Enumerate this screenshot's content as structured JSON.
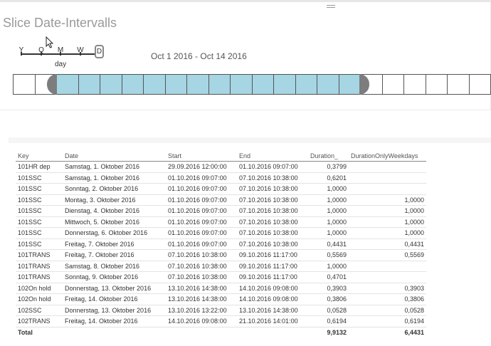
{
  "visual": {
    "title": "Slice Date-Intervalls",
    "granularity": {
      "levels": [
        "Y",
        "Q",
        "M",
        "W",
        "D"
      ],
      "selected": "D",
      "current_label": "day"
    },
    "range_label": "Oct 1 2016 - Oct 14 2016",
    "timeline": {
      "total_cells": 22,
      "selected_start_index": 2,
      "selected_end_index": 15,
      "selected_color": "#a6d5e3",
      "handle_color": "#7d7d7d"
    }
  },
  "table": {
    "columns": [
      "Key",
      "Date",
      "Start",
      "End",
      "Duration_",
      "DurationOnlyWeekdays"
    ],
    "rows": [
      [
        "101HR dep",
        "Samstag, 1. Oktober 2016",
        "29.09.2016 12:00:00",
        "01.10.2016 09:07:00",
        "0,3799",
        ""
      ],
      [
        "101SSC",
        "Samstag, 1. Oktober 2016",
        "01.10.2016 09:07:00",
        "07.10.2016 10:38:00",
        "0,6201",
        ""
      ],
      [
        "101SSC",
        "Sonntag, 2. Oktober 2016",
        "01.10.2016 09:07:00",
        "07.10.2016 10:38:00",
        "1,0000",
        ""
      ],
      [
        "101SSC",
        "Montag, 3. Oktober 2016",
        "01.10.2016 09:07:00",
        "07.10.2016 10:38:00",
        "1,0000",
        "1,0000"
      ],
      [
        "101SSC",
        "Dienstag, 4. Oktober 2016",
        "01.10.2016 09:07:00",
        "07.10.2016 10:38:00",
        "1,0000",
        "1,0000"
      ],
      [
        "101SSC",
        "Mittwoch, 5. Oktober 2016",
        "01.10.2016 09:07:00",
        "07.10.2016 10:38:00",
        "1,0000",
        "1,0000"
      ],
      [
        "101SSC",
        "Donnerstag, 6. Oktober 2016",
        "01.10.2016 09:07:00",
        "07.10.2016 10:38:00",
        "1,0000",
        "1,0000"
      ],
      [
        "101SSC",
        "Freitag, 7. Oktober 2016",
        "01.10.2016 09:07:00",
        "07.10.2016 10:38:00",
        "0,4431",
        "0,4431"
      ],
      [
        "101TRANS",
        "Freitag, 7. Oktober 2016",
        "07.10.2016 10:38:00",
        "09.10.2016 11:17:00",
        "0,5569",
        "0,5569"
      ],
      [
        "101TRANS",
        "Samstag, 8. Oktober 2016",
        "07.10.2016 10:38:00",
        "09.10.2016 11:17:00",
        "1,0000",
        ""
      ],
      [
        "101TRANS",
        "Sonntag, 9. Oktober 2016",
        "07.10.2016 10:38:00",
        "09.10.2016 11:17:00",
        "0,4701",
        ""
      ],
      [
        "102On hold",
        "Donnerstag, 13. Oktober 2016",
        "13.10.2016 14:38:00",
        "14.10.2016 09:08:00",
        "0,3903",
        "0,3903"
      ],
      [
        "102On hold",
        "Freitag, 14. Oktober 2016",
        "13.10.2016 14:38:00",
        "14.10.2016 09:08:00",
        "0,3806",
        "0,3806"
      ],
      [
        "102SSC",
        "Donnerstag, 13. Oktober 2016",
        "13.10.2016 13:22:00",
        "13.10.2016 14:38:00",
        "0,0528",
        "0,0528"
      ],
      [
        "102TRANS",
        "Freitag, 14. Oktober 2016",
        "14.10.2016 09:08:00",
        "21.10.2016 14:01:00",
        "0,6194",
        "0,6194"
      ]
    ],
    "total": {
      "label": "Total",
      "duration": "9,9132",
      "duration_weekdays": "6,4431"
    }
  }
}
